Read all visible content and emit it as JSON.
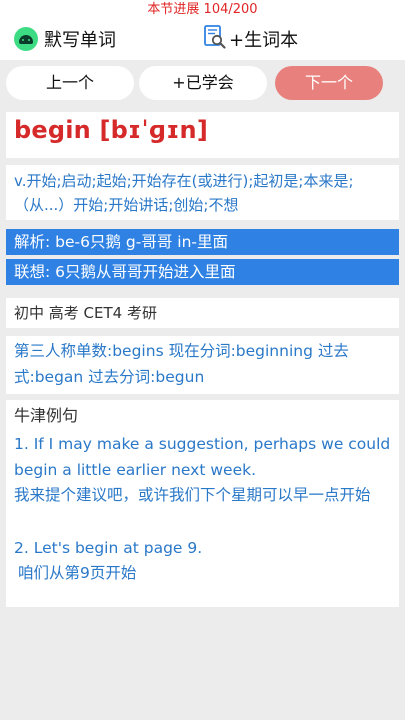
{
  "header": {
    "progress_label": "本节进展 104/200"
  },
  "toolbar": {
    "dictation_label": "默写单词",
    "add_vocab_label": "+生词本"
  },
  "nav": {
    "prev_label": "上一个",
    "learned_label": "+已学会",
    "next_label": "下一个"
  },
  "word": {
    "headword": "begin [bɪˈɡɪn]",
    "definition": "v.开始;启动;起始;开始存在(或进行);起初是;本来是;（从...）开始;开始讲话;创始;不想",
    "analysis": "解析: be-6只鹅 g-哥哥 in-里面",
    "association": "联想: 6只鹅从哥哥开始进入里面",
    "levels": "初中 高考 CET4 考研",
    "forms": "第三人称单数:begins 现在分词:beginning 过去式:began 过去分词:begun"
  },
  "examples": {
    "heading": "牛津例句",
    "items": [
      {
        "en": "1. If I may make a suggestion, perhaps we could begin a little earlier next week.",
        "zh": "我来提个建议吧，或许我们下个星期可以早一点开始"
      },
      {
        "en": "2. Let's begin at page 9.",
        "zh": "咱们从第9页开始"
      }
    ]
  },
  "colors": {
    "accent_red": "#e02525",
    "link_blue": "#2a78c8",
    "highlight_blue": "#2f82e3",
    "next_button": "#e8817d"
  },
  "icons": {
    "dictation": "android-icon",
    "add_vocab": "dictionary-search-icon"
  }
}
